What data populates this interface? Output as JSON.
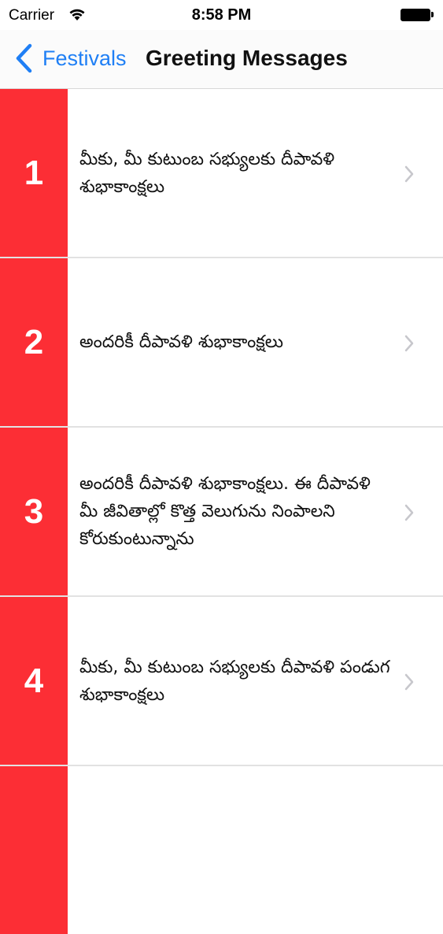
{
  "status_bar": {
    "carrier": "Carrier",
    "time": "8:58 PM"
  },
  "nav": {
    "back_label": "Festivals",
    "title": "Greeting Messages"
  },
  "colors": {
    "accent": "#1f7ff5",
    "number_bg": "#fc2e35"
  },
  "messages": [
    {
      "number": "1",
      "text": "మీకు, మీ కుటుంబ సభ్యులకు దీపావళి శుభాకాంక్షలు"
    },
    {
      "number": "2",
      "text": "అందరికీ దీపావళి శుభాకాంక్షలు"
    },
    {
      "number": "3",
      "text": "అందరికీ దీపావళి శుభాకాంక్షలు. ఈ దీపావళి మీ జీవితాల్లో కొత్త వెలుగును నింపాలని కోరుకుంటున్నాను"
    },
    {
      "number": "4",
      "text": "మీకు, మీ కుటుంబ సభ్యులకు దీపావళి పండుగ శుభాకాంక్షలు"
    }
  ]
}
